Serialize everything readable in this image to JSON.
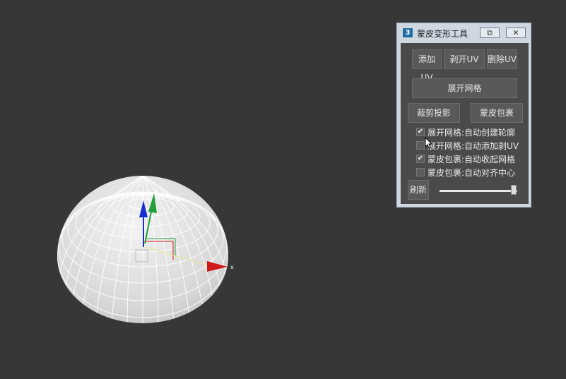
{
  "panel": {
    "app_icon": "3",
    "title": "蒙皮变形工具",
    "restore_icon": "restore-icon",
    "close_icon": "close-icon",
    "buttons": {
      "add_uv": "添加UV",
      "peel_uv": "剥开UV",
      "delete_uv": "删除UV",
      "unfold_mesh": "展开网格",
      "crop_project": "裁剪投影",
      "skin_wrap": "蒙皮包裹",
      "refresh": "刷新"
    },
    "options": [
      {
        "label": "展开网格:自动创建轮廓",
        "checked": true
      },
      {
        "label": "展开网格:自动添加剥UV",
        "checked": false
      },
      {
        "label": "蒙皮包裹:自动收起网格",
        "checked": true
      },
      {
        "label": "蒙皮包裹:自动对齐中心",
        "checked": false
      }
    ],
    "slider_value": 0.95
  },
  "colors": {
    "viewport_bg": "#373737",
    "panel_bg": "#cfd8e2",
    "panel_body": "#4a4a4a",
    "gizmo_x": "#d21a1a",
    "gizmo_y": "#1fa03a",
    "gizmo_z": "#1a2fd2"
  }
}
